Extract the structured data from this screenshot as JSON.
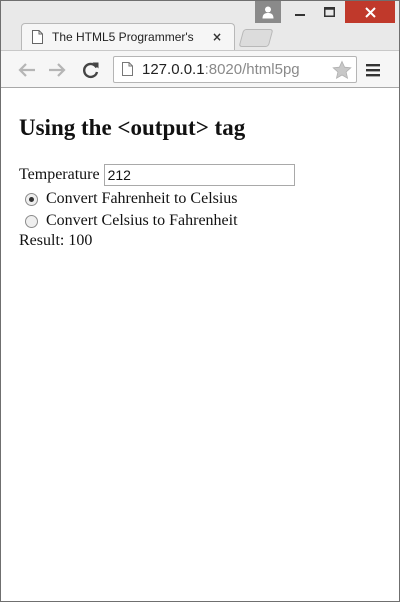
{
  "browser": {
    "tab": {
      "title": "The HTML5 Programmer's",
      "close_glyph": "×"
    },
    "address_bar": {
      "host": "127.0.0.1",
      "rest": ":8020/html5pg"
    },
    "icons": {
      "back": "back-arrow-icon",
      "forward": "forward-arrow-icon",
      "reload": "reload-icon",
      "page": "page-icon",
      "star": "star-icon",
      "menu": "hamburger-menu-icon",
      "user": "user-icon",
      "minimize": "minimize-icon",
      "maximize": "maximize-icon",
      "close": "close-icon"
    }
  },
  "page": {
    "heading": "Using the <output> tag",
    "temperature": {
      "label": "Temperature",
      "value": "212"
    },
    "options": [
      {
        "label": "Convert Fahrenheit to Celsius",
        "checked": true
      },
      {
        "label": "Convert Celsius to Fahrenheit",
        "checked": false
      }
    ],
    "result": {
      "label": "Result:",
      "value": "100"
    }
  }
}
